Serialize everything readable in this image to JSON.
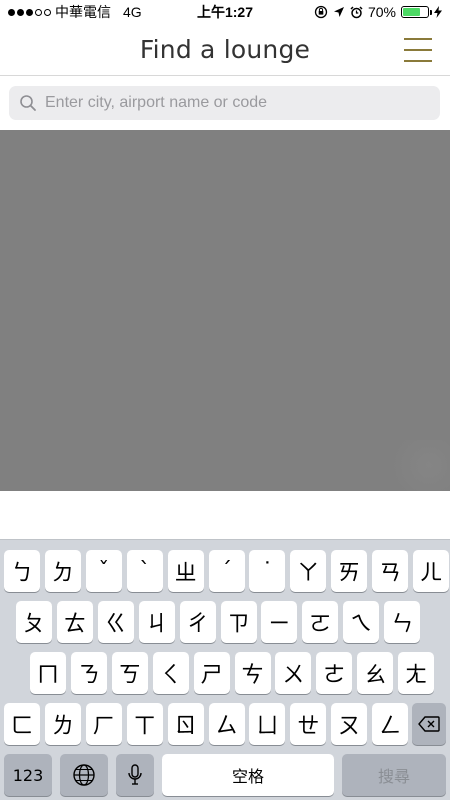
{
  "status_bar": {
    "carrier": "中華電信",
    "network": "4G",
    "time": "上午1:27",
    "battery_percent": "70%",
    "battery_level": 0.7,
    "battery_color": "#4cd964"
  },
  "nav": {
    "title": "Find a lounge",
    "menu_icon": "hamburger-menu-icon",
    "accent_color": "#8a7a3a"
  },
  "search": {
    "placeholder": "Enter city, airport name or code",
    "value": "",
    "icon": "search-icon"
  },
  "map": {
    "background_color": "#808080"
  },
  "keyboard": {
    "row1": [
      "ㄅ",
      "ㄉ",
      "ˇ",
      "ˋ",
      "ㄓ",
      "ˊ",
      "˙",
      "ㄚ",
      "ㄞ",
      "ㄢ",
      "ㄦ"
    ],
    "row2": [
      "ㄆ",
      "ㄊ",
      "ㄍ",
      "ㄐ",
      "ㄔ",
      "ㄗ",
      "ㄧ",
      "ㄛ",
      "ㄟ",
      "ㄣ"
    ],
    "row3": [
      "ㄇ",
      "ㄋ",
      "ㄎ",
      "ㄑ",
      "ㄕ",
      "ㄘ",
      "ㄨ",
      "ㄜ",
      "ㄠ",
      "ㄤ"
    ],
    "row4": [
      "ㄈ",
      "ㄌ",
      "ㄏ",
      "ㄒ",
      "ㄖ",
      "ㄙ",
      "ㄩ",
      "ㄝ",
      "ㄡ",
      "ㄥ"
    ],
    "numbers_label": "123",
    "globe_icon": "globe-icon",
    "mic_icon": "microphone-icon",
    "space_label": "空格",
    "search_label": "搜尋",
    "delete_icon": "backspace-icon"
  }
}
